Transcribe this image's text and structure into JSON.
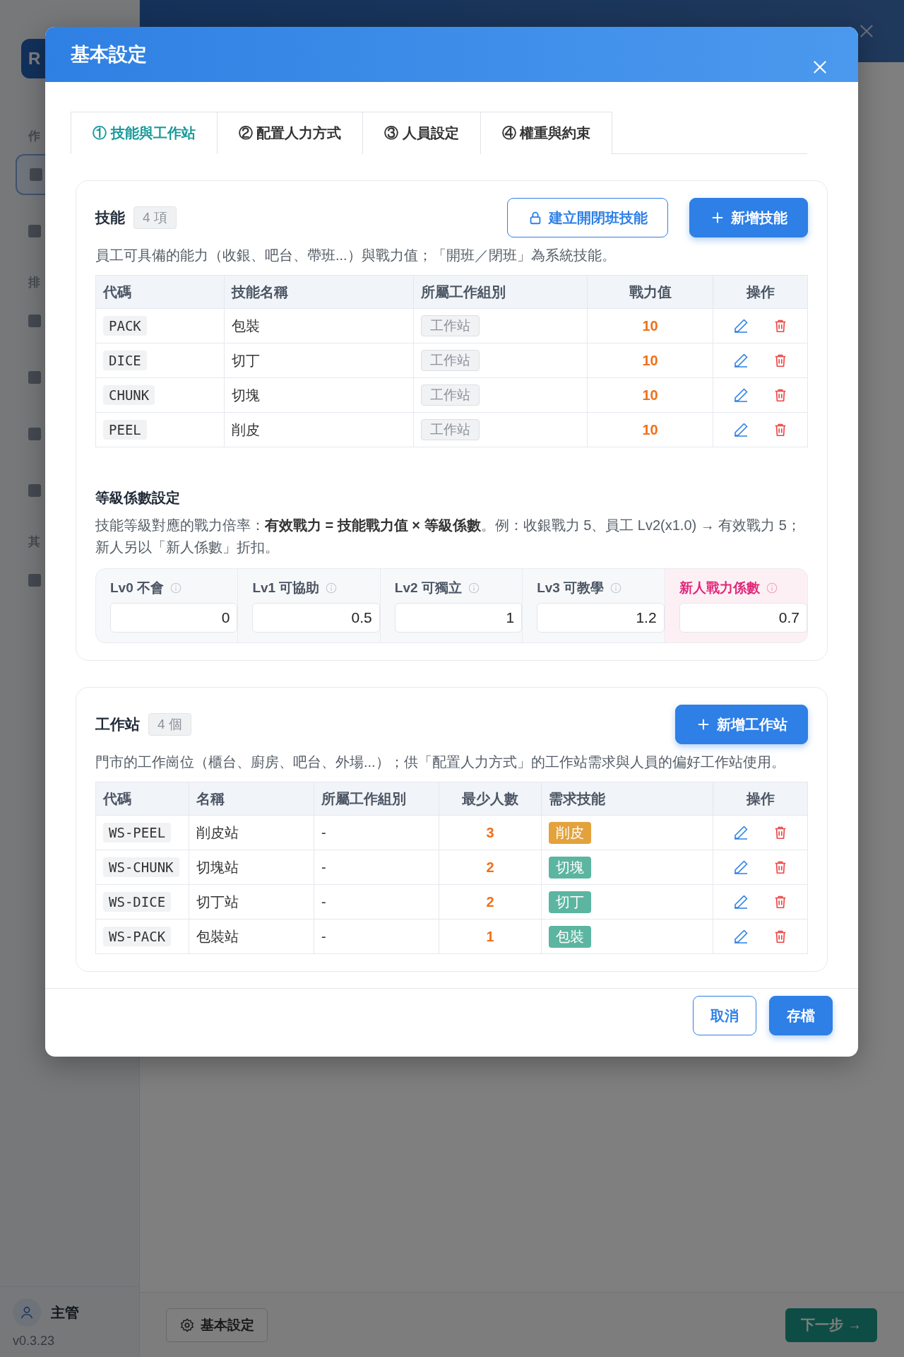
{
  "app": {
    "logo": "R",
    "sidebar_sections": [
      {
        "label": "作",
        "items": [
          {
            "selected": true
          },
          {
            "selected": false
          }
        ]
      },
      {
        "label": "排",
        "items": [
          {
            "selected": false
          },
          {
            "selected": false
          },
          {
            "selected": false
          },
          {
            "selected": false
          }
        ]
      },
      {
        "label": "其",
        "items": [
          {
            "selected": false
          }
        ]
      }
    ],
    "user": {
      "name": "主管",
      "version": "v0.3.23"
    },
    "footer_buttons": [
      {
        "kind": "settings",
        "label": "基本設定"
      },
      {
        "kind": "next",
        "label": "下一步 →"
      }
    ]
  },
  "dialog": {
    "title": "基本設定",
    "tabs": [
      {
        "label": "① 技能與工作站",
        "selected": true
      },
      {
        "label": "② 配置人力方式",
        "selected": false
      },
      {
        "label": "③ 人員設定",
        "selected": false
      },
      {
        "label": "④ 權重與約束",
        "selected": false
      }
    ],
    "skills": {
      "title": "技能",
      "count": "4 項",
      "buttons": [
        {
          "kind": "lock",
          "label": "建立開閉班技能"
        },
        {
          "kind": "add",
          "label": "新增技能"
        }
      ],
      "description": "員工可具備的能力（收銀、吧台、帶班...）與戰力值；「開班／閉班」為系統技能。",
      "columns": [
        "代碼",
        "技能名稱",
        "所屬工作組別",
        "戰力值",
        "操作"
      ],
      "rows": [
        {
          "code": "PACK",
          "name": "包裝",
          "group": "工作站",
          "power": "10"
        },
        {
          "code": "DICE",
          "name": "切丁",
          "group": "工作站",
          "power": "10"
        },
        {
          "code": "CHUNK",
          "name": "切塊",
          "group": "工作站",
          "power": "10"
        },
        {
          "code": "PEEL",
          "name": "削皮",
          "group": "工作站",
          "power": "10"
        }
      ]
    },
    "levels": {
      "title": "等級係數設定",
      "description": "技能等級對應的戰力倍率：**有效戰力 = 技能戰力值 × 等級係數**。例：收銀戰力 5、員工 Lv2(x1.0) → 有效戰力 5；新人另以「新人係數」折扣。",
      "fields": [
        {
          "kind": "level",
          "label": "Lv0 不會",
          "value": "0"
        },
        {
          "kind": "level",
          "label": "Lv1 可協助",
          "value": "0.5"
        },
        {
          "kind": "level",
          "label": "Lv2 可獨立",
          "value": "1"
        },
        {
          "kind": "level",
          "label": "Lv3 可教學",
          "value": "1.2"
        },
        {
          "kind": "newcomer",
          "label": "新人戰力係數",
          "value": "0.7"
        }
      ]
    },
    "workstations": {
      "title": "工作站",
      "count": "4 個",
      "buttons": [
        {
          "kind": "add",
          "label": "新增工作站"
        }
      ],
      "description": "門市的工作崗位（櫃台、廚房、吧台、外場...）；供「配置人力方式」的工作站需求與人員的偏好工作站使用。",
      "columns": [
        "代碼",
        "名稱",
        "所屬工作組別",
        "最少人數",
        "需求技能",
        "操作"
      ],
      "rows": [
        {
          "code": "WS-PEEL",
          "name": "削皮站",
          "group": "-",
          "min": "3",
          "skill": "削皮",
          "color": "#e3a23b"
        },
        {
          "code": "WS-CHUNK",
          "name": "切塊站",
          "group": "-",
          "min": "2",
          "skill": "切塊",
          "color": "#5bb5a0"
        },
        {
          "code": "WS-DICE",
          "name": "切丁站",
          "group": "-",
          "min": "2",
          "skill": "切丁",
          "color": "#5bb5a0"
        },
        {
          "code": "WS-PACK",
          "name": "包裝站",
          "group": "-",
          "min": "1",
          "skill": "包裝",
          "color": "#5bb5a0"
        }
      ]
    },
    "footer_buttons": [
      {
        "kind": "cancel",
        "label": "取消"
      },
      {
        "kind": "save",
        "label": "存檔"
      }
    ]
  }
}
